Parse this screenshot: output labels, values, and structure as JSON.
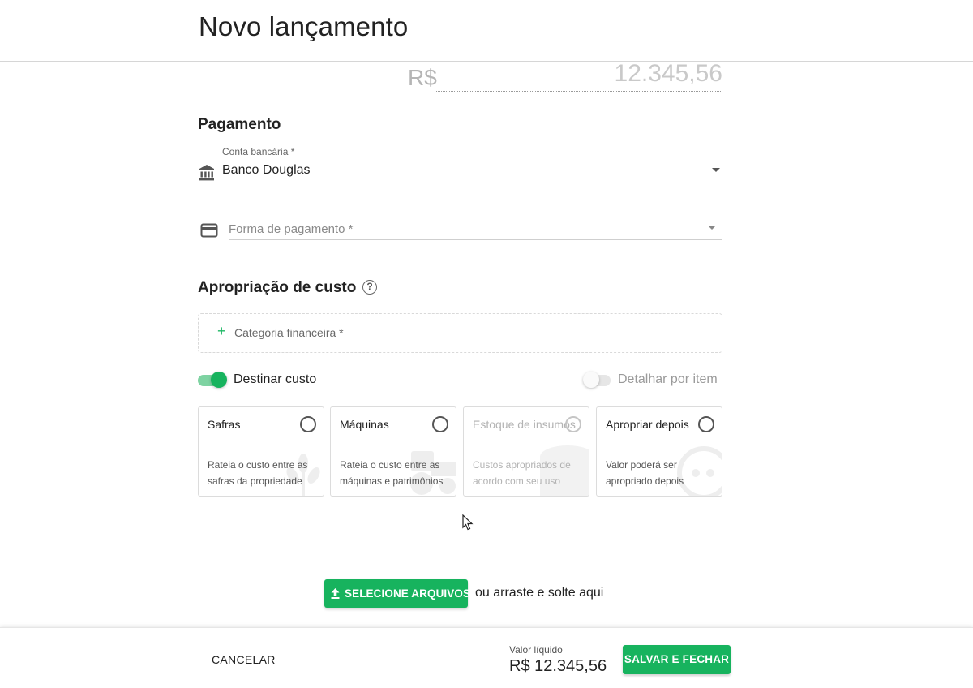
{
  "header": {
    "title": "Novo lançamento"
  },
  "amount": {
    "currency": "R$",
    "value": "12.345,56"
  },
  "payment": {
    "section_title": "Pagamento",
    "bank_account": {
      "label": "Conta bancária *",
      "value": "Banco Douglas",
      "icon": "bank-icon"
    },
    "payment_method": {
      "placeholder": "Forma de pagamento *",
      "icon": "credit-card-icon"
    }
  },
  "cost": {
    "section_title": "Apropriação de custo",
    "help_icon": "?",
    "category_add": {
      "plus": "+",
      "label": "Categoria financeira *"
    },
    "destinar_toggle": {
      "label": "Destinar custo",
      "on": true
    },
    "detalhar_toggle": {
      "label": "Detalhar por item",
      "on": false
    },
    "cards": [
      {
        "title": "Safras",
        "description": "Rateia o custo entre as safras da propriedade",
        "disabled": false,
        "icon": "wheat-icon"
      },
      {
        "title": "Máquinas",
        "description": "Rateia o custo entre as máquinas e patrimônios",
        "disabled": false,
        "icon": "tractor-icon"
      },
      {
        "title": "Estoque de insumos",
        "description": "Custos apropriados de acordo com seu uso",
        "disabled": true,
        "icon": "box-icon"
      },
      {
        "title": "Apropriar depois",
        "description": "Valor poderá ser apropriado depois",
        "disabled": false,
        "icon": "chat-bubble-icon"
      }
    ]
  },
  "upload": {
    "button_label": "SELECIONE ARQUIVOS",
    "hint": "ou arraste e solte aqui"
  },
  "footer": {
    "cancel_label": "CANCELAR",
    "net_label": "Valor líquido",
    "net_value": "R$ 12.345,56",
    "save_label": "SALVAR E FECHAR"
  },
  "colors": {
    "accent": "#17b35e",
    "accent_light": "#7ed3a2",
    "text": "#222222",
    "muted": "#8a8a8a"
  }
}
